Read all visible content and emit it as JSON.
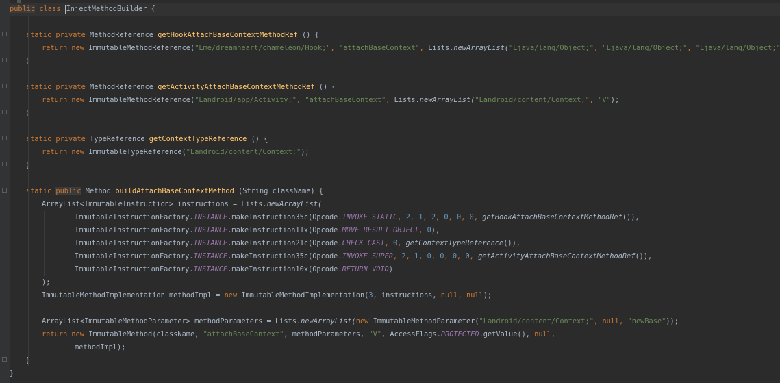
{
  "code": {
    "class_decl": {
      "kw1": "public",
      "kw2": "class",
      "name": "InjectMethodBuilder",
      "brace": " {"
    },
    "m1": {
      "kw": "static private ",
      "type": "MethodReference ",
      "name": "getHookAttachBaseContextMethodRef",
      "sig": " () {",
      "ret_kw": "return new ",
      "ctor": "ImmutableMethodReference(",
      "a1": "\"Lme/dreamheart/chameleon/Hook;\"",
      "a2": "\"attachBaseContext\"",
      "lists": "Lists.",
      "call": "newArrayList(",
      "a3": "\"Ljava/lang/Object;\"",
      "a4": "\"Ljava/lang/Object;\"",
      "a5": "\"Ljava/lang/Object;\"",
      "end": ");"
    },
    "m2": {
      "kw": "static private ",
      "type": "MethodReference ",
      "name": "getActivityAttachBaseContextMethodRef",
      "sig": " () {",
      "ret_kw": "return new ",
      "ctor": "ImmutableMethodReference(",
      "a1": "\"Landroid/app/Activity;\"",
      "a2": "\"attachBaseContext\"",
      "lists": "Lists.",
      "call": "newArrayList(",
      "a3": "\"Landroid/content/Context;\"",
      "a4": "\"V\"",
      "end": ");"
    },
    "m3": {
      "kw": "static private ",
      "type": "TypeReference ",
      "name": "getContextTypeReference",
      "sig": " () {",
      "ret_kw": "return new ",
      "ctor": "ImmutableTypeReference(",
      "a1": "\"Landroid/content/Context;\"",
      "end": ");"
    },
    "m4": {
      "kw1": "static ",
      "kw2": "public",
      "type": " Method ",
      "name": "buildAttachBaseContextMethod",
      "sig": " (String className) {",
      "l1a": "ArrayList<ImmutableInstruction> instructions = Lists.",
      "l1b": "newArrayList(",
      "f": "ImmutableInstructionFactory.",
      "inst": "INSTANCE",
      "r1": {
        "call": ".makeInstruction35c(Opcode.",
        "op": "INVOKE_STATIC",
        "nums": [
          "2",
          "1",
          "2",
          "0",
          "0",
          "0"
        ],
        "ref": "getHookAttachBaseContextMethodRef",
        "end": "()),"
      },
      "r2": {
        "call": ".makeInstruction11x(Opcode.",
        "op": "MOVE_RESULT_OBJECT",
        "nums": [
          "0"
        ],
        "end": "),"
      },
      "r3": {
        "call": ".makeInstruction21c(Opcode.",
        "op": "CHECK_CAST",
        "nums": [
          "0"
        ],
        "ref": "getContextTypeReference",
        "end": "()),"
      },
      "r4": {
        "call": ".makeInstruction35c(Opcode.",
        "op": "INVOKE_SUPER",
        "nums": [
          "2",
          "1",
          "0",
          "0",
          "0",
          "0"
        ],
        "ref": "getActivityAttachBaseContextMethodRef",
        "end": "()),"
      },
      "r5": {
        "call": ".makeInstruction10x(Opcode.",
        "op": "RETURN_VOID",
        "end": ")"
      },
      "close": ");",
      "impl_a": "ImmutableMethodImplementation methodImpl = ",
      "impl_new": "new ",
      "impl_b": "ImmutableMethodImplementation(",
      "impl_n": "3",
      "impl_c": ", instructions, ",
      "null1": "null",
      "null2": "null",
      "impl_end": ");",
      "params_a": "ArrayList<ImmutableMethodParameter> methodParameters = Lists.",
      "params_call": "newArrayList(",
      "params_new": "new ",
      "params_b": "ImmutableMethodParameter(",
      "params_s1": "\"Landroid/content/Context;\"",
      "params_null": "null",
      "params_s2": "\"newBase\"",
      "params_end": "));",
      "ret_kw": "return new ",
      "ret_b": "ImmutableMethod(className, ",
      "ret_s1": "\"attachBaseContext\"",
      "ret_c": ", methodParameters, ",
      "ret_s2": "\"V\"",
      "ret_d": ", AccessFlags.",
      "ret_flag": "PROTECTED",
      "ret_e": ".getValue(), ",
      "ret_null": "null",
      "ret_f": ",",
      "ret_g": "methodImpl);"
    },
    "close_method": "}",
    "close_class": "}"
  }
}
